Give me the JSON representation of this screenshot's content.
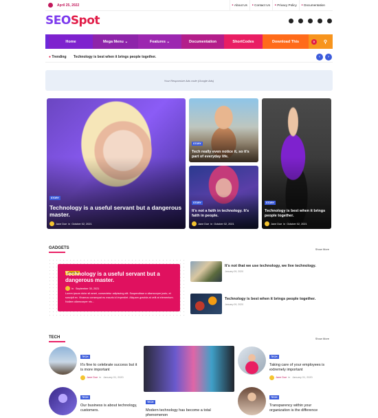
{
  "topbar": {
    "date": "April 25, 2022",
    "links": [
      "About Us",
      "Contact Us",
      "Privacy Policy",
      "Documentation"
    ]
  },
  "logo": {
    "part1": "SEO",
    "part2": "Spot"
  },
  "social": [
    "facebook-icon",
    "whatsapp-icon",
    "telegram-icon",
    "twitter-icon",
    "instagram-icon"
  ],
  "nav": {
    "items": [
      "Home",
      "Mega Menu",
      "Features",
      "Documentation",
      "ShortCodes",
      "Download This"
    ],
    "badge": "0"
  },
  "trending": {
    "label": "Trending",
    "text": "Technology is best when it brings people together."
  },
  "ad": {
    "text": "Your Responsive Ads code (Google Ads)"
  },
  "hero": [
    {
      "tag": "STORY",
      "title": "Technology is a useful servant but a dangerous master.",
      "author": "Jane Doe",
      "date": "October 02, 2021"
    },
    {
      "tag": "STORY",
      "title": "Tech really even notice it, so it's part of everyday life.",
      "author": "Jane Doe",
      "date": "October 02, 2021"
    },
    {
      "tag": "STORY",
      "title": "It's not a faith in technology. It's faith in people.",
      "author": "Jane Doe",
      "date": "October 02, 2021"
    },
    {
      "tag": "STORY",
      "title": "Technology is best when it brings people together.",
      "author": "Jane Doe",
      "date": "October 02, 2021"
    }
  ],
  "gadgets": {
    "heading": "GADGETS",
    "show_more": "Show More",
    "featured": {
      "tag": "GADGETS",
      "title": "Technology is a useful servant but a dangerous master.",
      "date": "September 30, 2021",
      "excerpt": "Lorem ipsum dolor sit amet, consectetur adipiscing elit. Suspendisse a ullamcorper justo, et suscipit ex. Vivamus consequat eu mauris id imperdiet. Aliquam gravida at velit at elementum. Nullam ullamcorper nis..."
    },
    "list": [
      {
        "title": "It's not that we use technology, we live technology.",
        "date": "January 09, 2020"
      },
      {
        "title": "Technology is best when it brings people together.",
        "date": "January 09, 2020"
      }
    ]
  },
  "tech": {
    "heading": "TECH",
    "show_more": "Show More",
    "left": [
      {
        "tag": "TECH",
        "title": "It's fine to celebrate success but it is more important",
        "author": "Jane Doe",
        "date": "January 01, 2020"
      },
      {
        "tag": "TECH",
        "title": "Our business is about technology, customers."
      }
    ],
    "middle": {
      "tag": "TECH",
      "title": "Modern technology has become a total phenomenon"
    },
    "right": [
      {
        "tag": "TECH",
        "title": "Taking care of your employees is extremely important",
        "author": "Jane Doe",
        "date": "January 01, 2020"
      },
      {
        "tag": "TECH",
        "title": "Transparency within your organization is the difference"
      }
    ]
  }
}
